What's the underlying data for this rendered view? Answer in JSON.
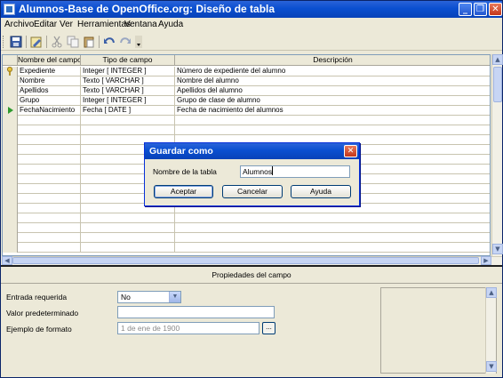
{
  "window": {
    "title": "Alumnos-Base de OpenOffice.org: Diseño de tabla",
    "minimize": "_",
    "restore": "❐",
    "close": "✕"
  },
  "menu": [
    "Archivo",
    "Editar",
    "Ver",
    "Herramientas",
    "Ventana",
    "Ayuda"
  ],
  "toolbar": {
    "icons": [
      "save-icon",
      "edit-icon",
      "cut-icon",
      "copy-icon",
      "paste-icon",
      "undo-icon",
      "redo-icon",
      "dropdown-icon"
    ]
  },
  "grid": {
    "headers": [
      "Nombre del campo",
      "Tipo de campo",
      "Descripción"
    ],
    "rows": [
      {
        "name": "Expediente",
        "type": "Integer [ INTEGER ]",
        "desc": "Número de expediente del alumno",
        "marker": "key"
      },
      {
        "name": "Nombre",
        "type": "Texto [ VARCHAR ]",
        "desc": "Nombre del alumno",
        "marker": ""
      },
      {
        "name": "Apellidos",
        "type": "Texto [ VARCHAR ]",
        "desc": "Apellidos del alumno",
        "marker": ""
      },
      {
        "name": "Grupo",
        "type": "Integer [ INTEGER ]",
        "desc": "Grupo de clase de alumno",
        "marker": ""
      },
      {
        "name": "FechaNacimiento",
        "type": "Fecha [ DATE ]",
        "desc": "Fecha de nacimiento del alumnos",
        "marker": "current"
      }
    ],
    "empty_rows": 14
  },
  "properties": {
    "title": "Propiedades del campo",
    "required_label": "Entrada requerida",
    "required_value": "No",
    "default_label": "Valor predeterminado",
    "default_value": "",
    "format_label": "Ejemplo de formato",
    "format_value": "1 de ene de 1900",
    "format_button": "..."
  },
  "dialog": {
    "title": "Guardar como",
    "close": "✕",
    "table_label": "Nombre de la tabla",
    "table_value": "Alumnos",
    "ok": "Aceptar",
    "cancel": "Cancelar",
    "help": "Ayuda"
  },
  "colors": {
    "titlebar": "#0a4fd0",
    "window_bg": "#ece9d8",
    "close_red": "#c4361a"
  }
}
